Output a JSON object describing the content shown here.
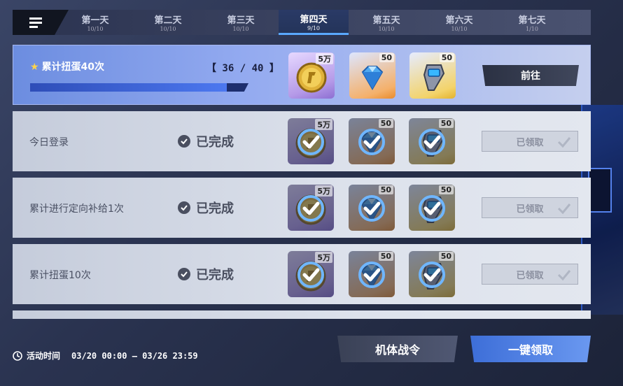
{
  "tabs": [
    {
      "label": "第一天",
      "progress": "10/10",
      "active": false
    },
    {
      "label": "第二天",
      "progress": "10/10",
      "active": false
    },
    {
      "label": "第三天",
      "progress": "10/10",
      "active": false
    },
    {
      "label": "第四天",
      "progress": "9/10",
      "active": true
    },
    {
      "label": "第五天",
      "progress": "10/10",
      "active": false
    },
    {
      "label": "第六天",
      "progress": "10/10",
      "active": false
    },
    {
      "label": "第七天",
      "progress": "1/10",
      "active": false
    }
  ],
  "tasks": [
    {
      "title": "累计扭蛋40次",
      "progress_text": "【 36 / 40 】",
      "progress_fraction": 0.9,
      "status": "active",
      "button_label": "前往",
      "rewards": [
        {
          "qty": "5万",
          "icon": "gold-coin-icon",
          "frame": "purple"
        },
        {
          "qty": "50",
          "icon": "blue-diamond-icon",
          "frame": "orange"
        },
        {
          "qty": "50",
          "icon": "mech-part-icon",
          "frame": "yellow"
        }
      ]
    },
    {
      "title": "今日登录",
      "status_label": "已完成",
      "status": "claimed",
      "button_label": "已领取",
      "rewards": [
        {
          "qty": "5万",
          "icon": "gold-coin-icon",
          "frame": "purple"
        },
        {
          "qty": "50",
          "icon": "blue-diamond-icon",
          "frame": "orange"
        },
        {
          "qty": "50",
          "icon": "mech-part-icon",
          "frame": "yellow"
        }
      ]
    },
    {
      "title": "累计进行定向补给1次",
      "status_label": "已完成",
      "status": "claimed",
      "button_label": "已领取",
      "rewards": [
        {
          "qty": "5万",
          "icon": "gold-coin-icon",
          "frame": "purple"
        },
        {
          "qty": "50",
          "icon": "blue-diamond-icon",
          "frame": "orange"
        },
        {
          "qty": "50",
          "icon": "mech-part-icon",
          "frame": "yellow"
        }
      ]
    },
    {
      "title": "累计扭蛋10次",
      "status_label": "已完成",
      "status": "claimed",
      "button_label": "已领取",
      "rewards": [
        {
          "qty": "5万",
          "icon": "gold-coin-icon",
          "frame": "purple"
        },
        {
          "qty": "50",
          "icon": "blue-diamond-icon",
          "frame": "orange"
        },
        {
          "qty": "50",
          "icon": "mech-part-icon",
          "frame": "yellow"
        }
      ]
    }
  ],
  "footer": {
    "time_label": "活动时间",
    "time_value": "03/20 00:00 – 03/26 23:59",
    "pass_button": "机体战令",
    "claim_all_button": "一键领取"
  },
  "colors": {
    "accent": "#5aa8ff",
    "active_row": "#93aaf0",
    "claim_all": "#4f82e2"
  }
}
